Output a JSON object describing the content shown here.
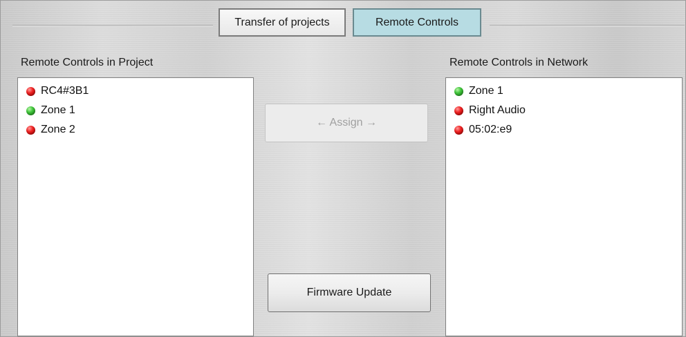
{
  "tabs": [
    {
      "label": "Transfer of projects",
      "active": false
    },
    {
      "label": "Remote Controls",
      "active": true
    }
  ],
  "project_panel": {
    "title": "Remote Controls in Project",
    "items": [
      {
        "label": "RC4#3B1",
        "status": "red"
      },
      {
        "label": "Zone 1",
        "status": "green"
      },
      {
        "label": "Zone 2",
        "status": "red"
      }
    ]
  },
  "network_panel": {
    "title": "Remote Controls in Network",
    "items": [
      {
        "label": "Zone 1",
        "status": "green"
      },
      {
        "label": "Right Audio",
        "status": "red"
      },
      {
        "label": "05:02:e9",
        "status": "red"
      }
    ]
  },
  "buttons": {
    "assign_label": "← Assign →",
    "assign_enabled": false,
    "firmware_label": "Firmware Update"
  },
  "colors": {
    "active_tab": "#b7dce3",
    "status_red": "#ee2222",
    "status_green": "#3fc43a"
  }
}
